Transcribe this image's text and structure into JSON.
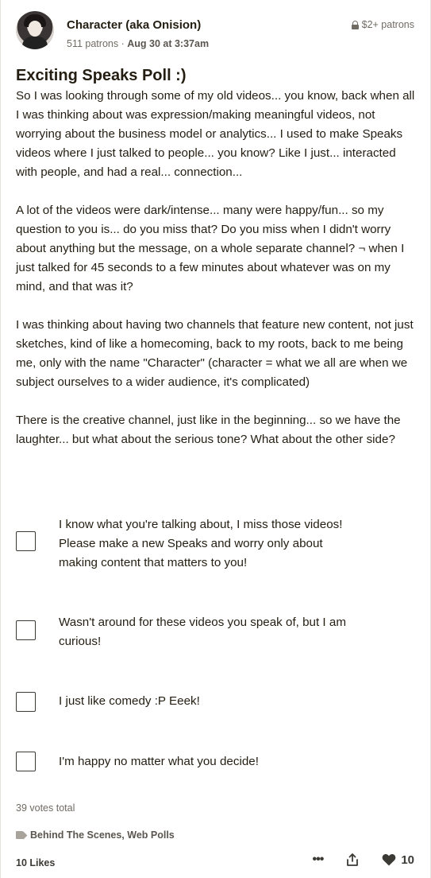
{
  "post": {
    "author": "Character (aka Onision)",
    "patrons": "511 patrons",
    "separator": "·",
    "date": "Aug 30 at 3:37am",
    "tier": "$2+ patrons",
    "title": "Exciting Speaks Poll :)",
    "paragraphs": [
      "So I was looking through some of my old videos... you know, back when all I was thinking about was expression/making meaningful videos, not worrying about the business model or analytics... I used to make Speaks videos where I just talked to people... you know? Like I just... interacted with people, and had a real... connection...",
      "A lot of the videos were dark/intense... many were happy/fun... so my question to you is... do you miss that? Do you miss when I didn't worry about anything but the message, on a whole separate channel? ¬ when I just talked for 45 seconds to a few minutes about whatever was on my mind, and that was it?",
      "I was thinking about having two channels that feature new content, not just sketches, kind of like a homecoming, back to my roots, back to me being me, only with the name \"Character\" (character = what we all are when we subject ourselves to a wider audience, it's complicated)",
      "There is the creative channel, just like in the beginning... so we have the laughter... but what about the serious tone? What about the other side?"
    ]
  },
  "poll": {
    "options": [
      "I know what you're talking about, I miss those videos! Please make a new Speaks and worry only about making content that matters to you!",
      "Wasn't around for these videos you speak of, but I am curious!",
      "I just like comedy :P Eeek!",
      "I'm happy no matter what you decide!"
    ],
    "votes_total": "39 votes total"
  },
  "footer": {
    "tags": "Behind The Scenes, Web Polls",
    "likes_label": "10 Likes",
    "more_icon": "•••",
    "like_count": "10"
  },
  "icons": {
    "lock": "lock-icon",
    "tag": "tag-icon",
    "more": "more-icon",
    "share": "share-icon",
    "heart": "heart-icon"
  },
  "colors": {
    "text": "#241e12",
    "muted": "#706c64",
    "background": "#ffffff"
  }
}
